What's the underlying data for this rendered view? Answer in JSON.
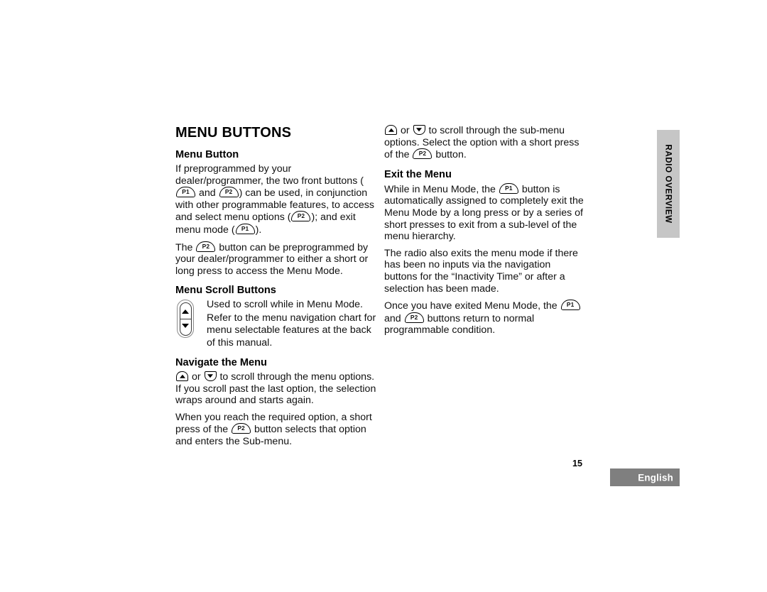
{
  "document": {
    "section_title": "MENU BUTTONS",
    "page_number": "15",
    "language": "English",
    "side_tab": "RADIO OVERVIEW"
  },
  "icons": {
    "p1": "P1",
    "p2": "P2",
    "up": "up-arrow-key",
    "down": "down-arrow-key",
    "rocker": "menu-scroll-rocker-switch"
  },
  "left_column": {
    "heading_menu_button": "Menu Button",
    "para_1_a": "If preprogrammed by your dealer/programmer, the two front buttons (",
    "para_1_b": " and ",
    "para_1_c": ") can be used, in conjunction with other programmable features, to access and select menu options (",
    "para_1_d": "); and exit menu mode (",
    "para_1_e": ").",
    "para_2_a": "The ",
    "para_2_b": " button can be preprogrammed by your dealer/programmer to either a short or long press to access the Menu Mode.",
    "heading_menu_scroll": "Menu Scroll Buttons",
    "scroll_line_1": "Used to scroll while in Menu Mode.",
    "scroll_line_2": "Refer to the menu navigation chart for menu selectable features at the back of this manual.",
    "heading_navigate": "Navigate the Menu",
    "nav_para_1_a": " or ",
    "nav_para_1_b": " to scroll through the menu options. If you scroll past the last option, the selection wraps around and starts again.",
    "nav_para_2_a": "When you reach the required option, a short press of the ",
    "nav_para_2_b": " button selects that option and enters the Sub-menu."
  },
  "right_column": {
    "para_1_a": " or ",
    "para_1_b": " to scroll through the sub-menu options. Select the option with a short press of the ",
    "para_1_c": " button.",
    "heading_exit": "Exit the Menu",
    "para_2_a": "While in Menu Mode, the ",
    "para_2_b": " button is automatically assigned to completely exit the Menu Mode by a long press or by a series of short presses to exit from a sub-level of the menu hierarchy.",
    "para_3": "The radio also exits the menu mode if there has been no inputs via the navigation buttons for the “Inactivity Time” or after a selection has been made.",
    "para_4_a": "Once you have exited Menu Mode, the ",
    "para_4_b": " and ",
    "para_4_c": " buttons return to normal programmable condition."
  }
}
